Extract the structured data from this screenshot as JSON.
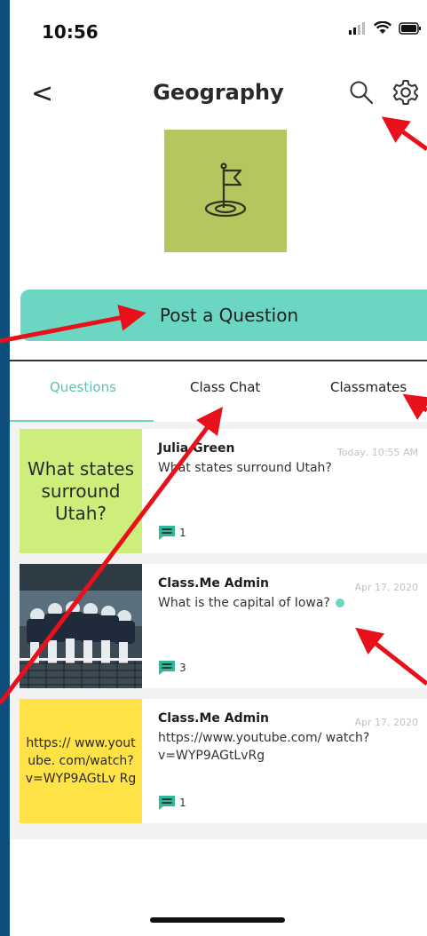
{
  "status_bar": {
    "time": "10:56"
  },
  "header": {
    "back_label": "<",
    "title": "Geography"
  },
  "class_logo": {
    "icon": "flag-on-target-icon",
    "color": "#b5c65f"
  },
  "post_button": {
    "label": "Post a Question",
    "color": "#6bd7c3"
  },
  "tabs": [
    {
      "label": "Questions",
      "active": true
    },
    {
      "label": "Class Chat",
      "active": false
    },
    {
      "label": "Classmates",
      "active": false
    }
  ],
  "questions": [
    {
      "thumb_text": "What states surround Utah?",
      "thumb_color": "#cdee7a",
      "author": "Julia Green",
      "date": "Today, 10:55 AM",
      "text": "What states surround Utah?",
      "comment_count": "1",
      "unread": false
    },
    {
      "thumb_text": "",
      "thumb_image": "team-huddle-photo",
      "author": "Class.Me Admin",
      "date": "Apr 17, 2020",
      "text": "What is the capital of Iowa?",
      "comment_count": "3",
      "unread": true
    },
    {
      "thumb_text": "https:// www.youtube. com/watch? v=WYP9AGtLv Rg",
      "thumb_color": "#ffe245",
      "author": "Class.Me Admin",
      "date": "Apr 17, 2020",
      "text": "https://www.youtube.com/ watch?v=WYP9AGtLvRg",
      "comment_count": "1",
      "unread": false
    }
  ],
  "colors": {
    "accent": "#6bd7c3",
    "annotation_arrow": "#e8101a",
    "frame": "#0d4e7a"
  }
}
